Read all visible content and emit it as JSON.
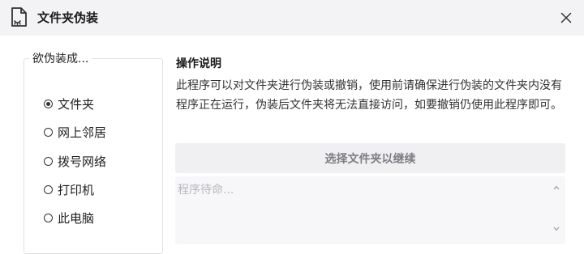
{
  "window": {
    "title": "文件夹伪装"
  },
  "options": {
    "legend": "欲伪装成...",
    "selected": "文件夹",
    "items": [
      {
        "label": "文件夹",
        "checked": true
      },
      {
        "label": "网上邻居",
        "checked": false
      },
      {
        "label": "拨号网络",
        "checked": false
      },
      {
        "label": "打印机",
        "checked": false
      },
      {
        "label": "此电脑",
        "checked": false
      }
    ]
  },
  "instructions": {
    "heading": "操作说明",
    "body": "此程序可以对文件夹进行伪装或撤销，使用前请确保进行伪装的文件夹内没有程序正在运行，伪装后文件夹将无法直接访问，如要撤销仍使用此程序即可。"
  },
  "actions": {
    "select_folder_label": "选择文件夹以继续"
  },
  "log": {
    "placeholder": "程序待命..."
  },
  "icons": {
    "app": "file-shield-icon",
    "close": "close-icon",
    "radio": "radio-icon",
    "scroll_up": "chevron-up-icon",
    "scroll_down": "chevron-down-icon"
  },
  "colors": {
    "titlebar_bg": "#f3f3f5",
    "button_bg": "#f0f0f2",
    "button_text": "#7d7d82",
    "placeholder_text": "#b8b8bd"
  }
}
